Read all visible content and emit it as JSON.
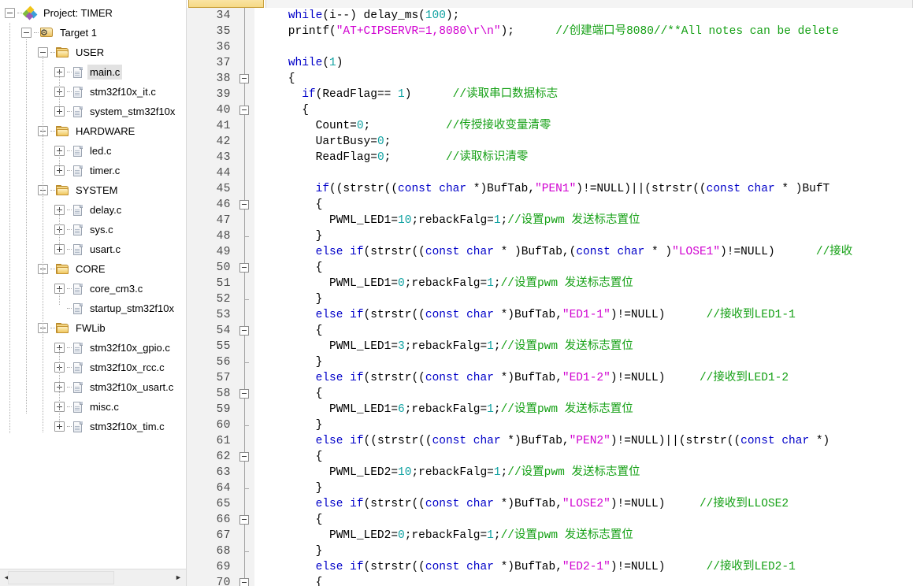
{
  "project_panel": {
    "title": "Project: TIMER",
    "hscroll": {
      "left_arrow": "◄",
      "right_arrow": "►"
    },
    "tree": [
      {
        "depth": 0,
        "label": "Project: TIMER",
        "icon": "project-icon",
        "expander": "minus",
        "selected": false
      },
      {
        "depth": 1,
        "label": "Target 1",
        "icon": "target-icon",
        "expander": "minus",
        "selected": false
      },
      {
        "depth": 2,
        "label": "USER",
        "icon": "folder-icon",
        "expander": "minus",
        "selected": false
      },
      {
        "depth": 3,
        "label": "main.c",
        "icon": "file-icon",
        "expander": "plus",
        "selected": true
      },
      {
        "depth": 3,
        "label": "stm32f10x_it.c",
        "icon": "file-icon",
        "expander": "plus",
        "selected": false
      },
      {
        "depth": 3,
        "label": "system_stm32f10x",
        "icon": "file-icon",
        "expander": "plus",
        "selected": false
      },
      {
        "depth": 2,
        "label": "HARDWARE",
        "icon": "folder-icon",
        "expander": "minus",
        "selected": false
      },
      {
        "depth": 3,
        "label": "led.c",
        "icon": "file-icon",
        "expander": "plus",
        "selected": false
      },
      {
        "depth": 3,
        "label": "timer.c",
        "icon": "file-icon",
        "expander": "plus",
        "selected": false
      },
      {
        "depth": 2,
        "label": "SYSTEM",
        "icon": "folder-icon",
        "expander": "minus",
        "selected": false
      },
      {
        "depth": 3,
        "label": "delay.c",
        "icon": "file-icon",
        "expander": "plus",
        "selected": false
      },
      {
        "depth": 3,
        "label": "sys.c",
        "icon": "file-icon",
        "expander": "plus",
        "selected": false
      },
      {
        "depth": 3,
        "label": "usart.c",
        "icon": "file-icon",
        "expander": "plus",
        "selected": false
      },
      {
        "depth": 2,
        "label": "CORE",
        "icon": "folder-icon",
        "expander": "minus",
        "selected": false
      },
      {
        "depth": 3,
        "label": "core_cm3.c",
        "icon": "file-icon",
        "expander": "plus",
        "selected": false
      },
      {
        "depth": 3,
        "label": "startup_stm32f10x",
        "icon": "file-icon",
        "expander": "none",
        "selected": false
      },
      {
        "depth": 2,
        "label": "FWLib",
        "icon": "folder-icon",
        "expander": "minus",
        "selected": false
      },
      {
        "depth": 3,
        "label": "stm32f10x_gpio.c",
        "icon": "file-icon",
        "expander": "plus",
        "selected": false
      },
      {
        "depth": 3,
        "label": "stm32f10x_rcc.c",
        "icon": "file-icon",
        "expander": "plus",
        "selected": false
      },
      {
        "depth": 3,
        "label": "stm32f10x_usart.c",
        "icon": "file-icon",
        "expander": "plus",
        "selected": false
      },
      {
        "depth": 3,
        "label": "misc.c",
        "icon": "file-icon",
        "expander": "plus",
        "selected": false
      },
      {
        "depth": 3,
        "label": "stm32f10x_tim.c",
        "icon": "file-icon",
        "expander": "plus",
        "selected": false
      }
    ]
  },
  "editor": {
    "first_line": 34,
    "lines": [
      {
        "n": 34,
        "fold": "stem",
        "tokens": [
          {
            "t": "    ",
            "c": "pl"
          },
          {
            "t": "while",
            "c": "kw"
          },
          {
            "t": "(i--) delay_ms(",
            "c": "pl"
          },
          {
            "t": "100",
            "c": "num"
          },
          {
            "t": ");",
            "c": "pl"
          }
        ]
      },
      {
        "n": 35,
        "fold": "stem",
        "tokens": [
          {
            "t": "    printf(",
            "c": "pl"
          },
          {
            "t": "\"AT+CIPSERVR=1,8080\\r\\n\"",
            "c": "str"
          },
          {
            "t": ");      ",
            "c": "pl"
          },
          {
            "t": "//创建端口号8080//**All notes can be delete",
            "c": "cm"
          }
        ]
      },
      {
        "n": 36,
        "fold": "stem",
        "tokens": []
      },
      {
        "n": 37,
        "fold": "stem",
        "tokens": [
          {
            "t": "    ",
            "c": "pl"
          },
          {
            "t": "while",
            "c": "kw"
          },
          {
            "t": "(",
            "c": "pl"
          },
          {
            "t": "1",
            "c": "num"
          },
          {
            "t": ")",
            "c": "pl"
          }
        ]
      },
      {
        "n": 38,
        "fold": "box",
        "tokens": [
          {
            "t": "    {",
            "c": "pl"
          }
        ]
      },
      {
        "n": 39,
        "fold": "stem",
        "tokens": [
          {
            "t": "      ",
            "c": "pl"
          },
          {
            "t": "if",
            "c": "kw"
          },
          {
            "t": "(ReadFlag== ",
            "c": "pl"
          },
          {
            "t": "1",
            "c": "num"
          },
          {
            "t": ")      ",
            "c": "pl"
          },
          {
            "t": "//读取串口数据标志",
            "c": "cm"
          }
        ]
      },
      {
        "n": 40,
        "fold": "box",
        "tokens": [
          {
            "t": "      {",
            "c": "pl"
          }
        ]
      },
      {
        "n": 41,
        "fold": "stem",
        "tokens": [
          {
            "t": "        Count=",
            "c": "pl"
          },
          {
            "t": "0",
            "c": "num"
          },
          {
            "t": ";           ",
            "c": "pl"
          },
          {
            "t": "//传授接收变量清零",
            "c": "cm"
          }
        ]
      },
      {
        "n": 42,
        "fold": "stem",
        "tokens": [
          {
            "t": "        UartBusy=",
            "c": "pl"
          },
          {
            "t": "0",
            "c": "num"
          },
          {
            "t": ";",
            "c": "pl"
          }
        ]
      },
      {
        "n": 43,
        "fold": "stem",
        "tokens": [
          {
            "t": "        ReadFlag=",
            "c": "pl"
          },
          {
            "t": "0",
            "c": "num"
          },
          {
            "t": ";        ",
            "c": "pl"
          },
          {
            "t": "//读取标识清零",
            "c": "cm"
          }
        ]
      },
      {
        "n": 44,
        "fold": "stem",
        "tokens": []
      },
      {
        "n": 45,
        "fold": "stem",
        "tokens": [
          {
            "t": "        ",
            "c": "pl"
          },
          {
            "t": "if",
            "c": "kw"
          },
          {
            "t": "((strstr((",
            "c": "pl"
          },
          {
            "t": "const char",
            "c": "kw"
          },
          {
            "t": " *)BufTab,",
            "c": "pl"
          },
          {
            "t": "\"PEN1\"",
            "c": "str"
          },
          {
            "t": ")!=NULL)||(strstr((",
            "c": "pl"
          },
          {
            "t": "const char",
            "c": "kw"
          },
          {
            "t": " * )BufT",
            "c": "pl"
          }
        ]
      },
      {
        "n": 46,
        "fold": "box",
        "tokens": [
          {
            "t": "        {",
            "c": "pl"
          }
        ]
      },
      {
        "n": 47,
        "fold": "stem",
        "tokens": [
          {
            "t": "          PWML_LED1=",
            "c": "pl"
          },
          {
            "t": "10",
            "c": "num"
          },
          {
            "t": ";rebackFalg=",
            "c": "pl"
          },
          {
            "t": "1",
            "c": "num"
          },
          {
            "t": ";",
            "c": "pl"
          },
          {
            "t": "//设置pwm 发送标志置位",
            "c": "cm"
          }
        ]
      },
      {
        "n": 48,
        "fold": "end",
        "tokens": [
          {
            "t": "        }",
            "c": "pl"
          }
        ]
      },
      {
        "n": 49,
        "fold": "stem",
        "tokens": [
          {
            "t": "        ",
            "c": "pl"
          },
          {
            "t": "else if",
            "c": "kw"
          },
          {
            "t": "(strstr((",
            "c": "pl"
          },
          {
            "t": "const char",
            "c": "kw"
          },
          {
            "t": " * )BufTab,(",
            "c": "pl"
          },
          {
            "t": "const char",
            "c": "kw"
          },
          {
            "t": " * )",
            "c": "pl"
          },
          {
            "t": "\"LOSE1\"",
            "c": "str"
          },
          {
            "t": ")!=NULL)      ",
            "c": "pl"
          },
          {
            "t": "//接收",
            "c": "cm"
          }
        ]
      },
      {
        "n": 50,
        "fold": "box",
        "tokens": [
          {
            "t": "        {",
            "c": "pl"
          }
        ]
      },
      {
        "n": 51,
        "fold": "stem",
        "tokens": [
          {
            "t": "          PWML_LED1=",
            "c": "pl"
          },
          {
            "t": "0",
            "c": "num"
          },
          {
            "t": ";rebackFalg=",
            "c": "pl"
          },
          {
            "t": "1",
            "c": "num"
          },
          {
            "t": ";",
            "c": "pl"
          },
          {
            "t": "//设置pwm 发送标志置位",
            "c": "cm"
          }
        ]
      },
      {
        "n": 52,
        "fold": "end",
        "tokens": [
          {
            "t": "        }",
            "c": "pl"
          }
        ]
      },
      {
        "n": 53,
        "fold": "stem",
        "tokens": [
          {
            "t": "        ",
            "c": "pl"
          },
          {
            "t": "else if",
            "c": "kw"
          },
          {
            "t": "(strstr((",
            "c": "pl"
          },
          {
            "t": "const char",
            "c": "kw"
          },
          {
            "t": " *)BufTab,",
            "c": "pl"
          },
          {
            "t": "\"ED1-1\"",
            "c": "str"
          },
          {
            "t": ")!=NULL)      ",
            "c": "pl"
          },
          {
            "t": "//接收到LED1-1",
            "c": "cm"
          }
        ]
      },
      {
        "n": 54,
        "fold": "box",
        "tokens": [
          {
            "t": "        {",
            "c": "pl"
          }
        ]
      },
      {
        "n": 55,
        "fold": "stem",
        "tokens": [
          {
            "t": "          PWML_LED1=",
            "c": "pl"
          },
          {
            "t": "3",
            "c": "num"
          },
          {
            "t": ";rebackFalg=",
            "c": "pl"
          },
          {
            "t": "1",
            "c": "num"
          },
          {
            "t": ";",
            "c": "pl"
          },
          {
            "t": "//设置pwm 发送标志置位",
            "c": "cm"
          }
        ]
      },
      {
        "n": 56,
        "fold": "end",
        "tokens": [
          {
            "t": "        }",
            "c": "pl"
          }
        ]
      },
      {
        "n": 57,
        "fold": "stem",
        "tokens": [
          {
            "t": "        ",
            "c": "pl"
          },
          {
            "t": "else if",
            "c": "kw"
          },
          {
            "t": "(strstr((",
            "c": "pl"
          },
          {
            "t": "const char",
            "c": "kw"
          },
          {
            "t": " *)BufTab,",
            "c": "pl"
          },
          {
            "t": "\"ED1-2\"",
            "c": "str"
          },
          {
            "t": ")!=NULL)     ",
            "c": "pl"
          },
          {
            "t": "//接收到LED1-2",
            "c": "cm"
          }
        ]
      },
      {
        "n": 58,
        "fold": "box",
        "tokens": [
          {
            "t": "        {",
            "c": "pl"
          }
        ]
      },
      {
        "n": 59,
        "fold": "stem",
        "tokens": [
          {
            "t": "          PWML_LED1=",
            "c": "pl"
          },
          {
            "t": "6",
            "c": "num"
          },
          {
            "t": ";rebackFalg=",
            "c": "pl"
          },
          {
            "t": "1",
            "c": "num"
          },
          {
            "t": ";",
            "c": "pl"
          },
          {
            "t": "//设置pwm 发送标志置位",
            "c": "cm"
          }
        ]
      },
      {
        "n": 60,
        "fold": "end",
        "tokens": [
          {
            "t": "        }",
            "c": "pl"
          }
        ]
      },
      {
        "n": 61,
        "fold": "stem",
        "tokens": [
          {
            "t": "        ",
            "c": "pl"
          },
          {
            "t": "else if",
            "c": "kw"
          },
          {
            "t": "((strstr((",
            "c": "pl"
          },
          {
            "t": "const char",
            "c": "kw"
          },
          {
            "t": " *)BufTab,",
            "c": "pl"
          },
          {
            "t": "\"PEN2\"",
            "c": "str"
          },
          {
            "t": ")!=NULL)||(strstr((",
            "c": "pl"
          },
          {
            "t": "const char",
            "c": "kw"
          },
          {
            "t": " *)",
            "c": "pl"
          }
        ]
      },
      {
        "n": 62,
        "fold": "box",
        "tokens": [
          {
            "t": "        {",
            "c": "pl"
          }
        ]
      },
      {
        "n": 63,
        "fold": "stem",
        "tokens": [
          {
            "t": "          PWML_LED2=",
            "c": "pl"
          },
          {
            "t": "10",
            "c": "num"
          },
          {
            "t": ";rebackFalg=",
            "c": "pl"
          },
          {
            "t": "1",
            "c": "num"
          },
          {
            "t": ";",
            "c": "pl"
          },
          {
            "t": "//设置pwm 发送标志置位",
            "c": "cm"
          }
        ]
      },
      {
        "n": 64,
        "fold": "end",
        "tokens": [
          {
            "t": "        }",
            "c": "pl"
          }
        ]
      },
      {
        "n": 65,
        "fold": "stem",
        "tokens": [
          {
            "t": "        ",
            "c": "pl"
          },
          {
            "t": "else if",
            "c": "kw"
          },
          {
            "t": "(strstr((",
            "c": "pl"
          },
          {
            "t": "const char",
            "c": "kw"
          },
          {
            "t": " *)BufTab,",
            "c": "pl"
          },
          {
            "t": "\"LOSE2\"",
            "c": "str"
          },
          {
            "t": ")!=NULL)     ",
            "c": "pl"
          },
          {
            "t": "//接收到LLOSE2",
            "c": "cm"
          }
        ]
      },
      {
        "n": 66,
        "fold": "box",
        "tokens": [
          {
            "t": "        {",
            "c": "pl"
          }
        ]
      },
      {
        "n": 67,
        "fold": "stem",
        "tokens": [
          {
            "t": "          PWML_LED2=",
            "c": "pl"
          },
          {
            "t": "0",
            "c": "num"
          },
          {
            "t": ";rebackFalg=",
            "c": "pl"
          },
          {
            "t": "1",
            "c": "num"
          },
          {
            "t": ";",
            "c": "pl"
          },
          {
            "t": "//设置pwm 发送标志置位",
            "c": "cm"
          }
        ]
      },
      {
        "n": 68,
        "fold": "end",
        "tokens": [
          {
            "t": "        }",
            "c": "pl"
          }
        ]
      },
      {
        "n": 69,
        "fold": "stem",
        "tokens": [
          {
            "t": "        ",
            "c": "pl"
          },
          {
            "t": "else if",
            "c": "kw"
          },
          {
            "t": "(strstr((",
            "c": "pl"
          },
          {
            "t": "const char",
            "c": "kw"
          },
          {
            "t": " *)BufTab,",
            "c": "pl"
          },
          {
            "t": "\"ED2-1\"",
            "c": "str"
          },
          {
            "t": ")!=NULL)      ",
            "c": "pl"
          },
          {
            "t": "//接收到LED2-1",
            "c": "cm"
          }
        ]
      },
      {
        "n": 70,
        "fold": "box",
        "tokens": [
          {
            "t": "        {",
            "c": "pl"
          }
        ]
      }
    ]
  },
  "colors": {
    "keyword": "#0000c8",
    "number": "#11a2a2",
    "string": "#d000d0",
    "comment": "#15a015",
    "gutter_bg": "#f2f2f2",
    "selection": "#e2e2e2"
  }
}
